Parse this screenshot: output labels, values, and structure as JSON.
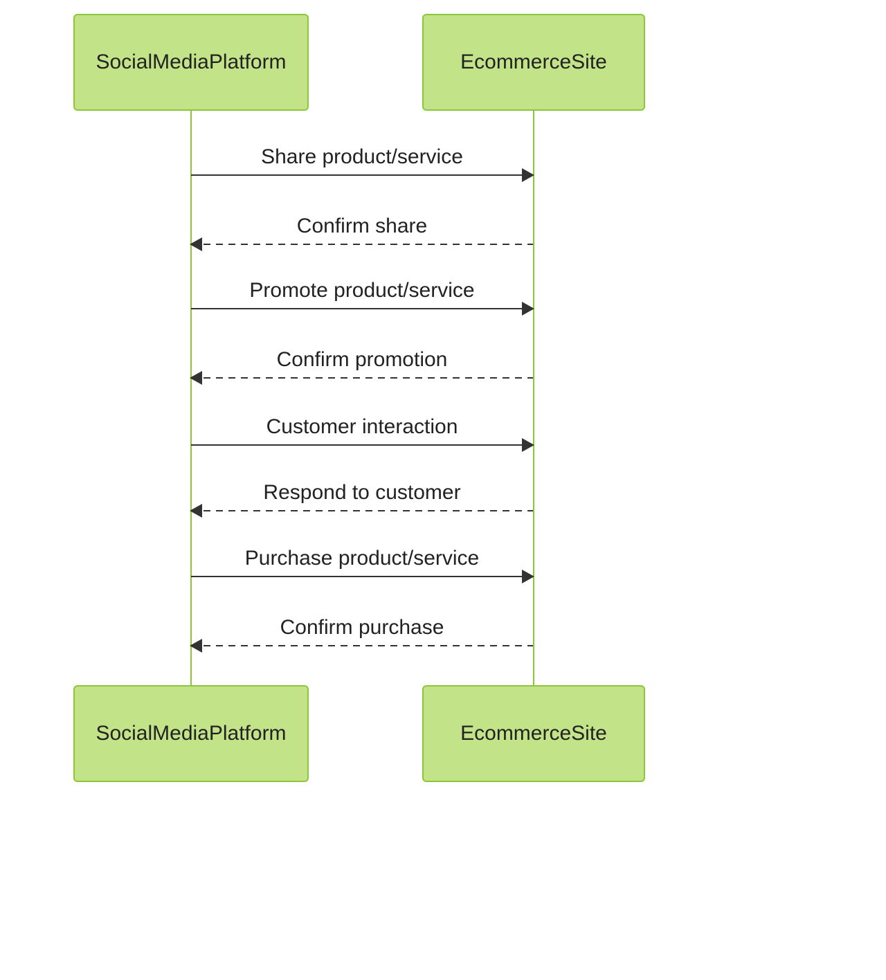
{
  "diagram": {
    "actors": {
      "left": "SocialMediaPlatform",
      "right": "EcommerceSite"
    },
    "messages": [
      {
        "text": "Share product/service",
        "direction": "right",
        "style": "solid"
      },
      {
        "text": "Confirm share",
        "direction": "left",
        "style": "dashed"
      },
      {
        "text": "Promote product/service",
        "direction": "right",
        "style": "solid"
      },
      {
        "text": "Confirm promotion",
        "direction": "left",
        "style": "dashed"
      },
      {
        "text": "Customer interaction",
        "direction": "right",
        "style": "solid"
      },
      {
        "text": "Respond to customer",
        "direction": "left",
        "style": "dashed"
      },
      {
        "text": "Purchase product/service",
        "direction": "right",
        "style": "solid"
      },
      {
        "text": "Confirm purchase",
        "direction": "left",
        "style": "dashed"
      }
    ]
  }
}
